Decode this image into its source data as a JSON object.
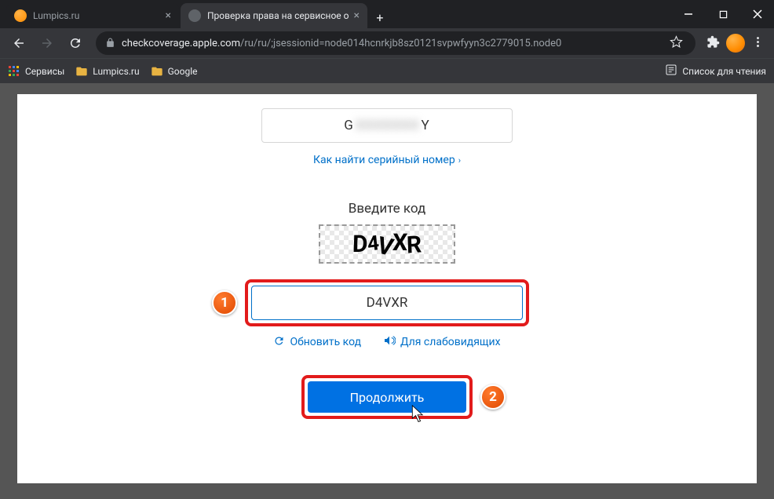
{
  "browser": {
    "tabs": [
      {
        "title": "Lumpics.ru",
        "active": false
      },
      {
        "title": "Проверка права на сервисное о",
        "active": true
      }
    ],
    "url_domain": "checkcoverage.apple.com",
    "url_path": "/ru/ru/;jsessionid=node014hcnrkjb8sz0121svpwfyyn3c2779015.node0",
    "bookmarks": {
      "services": "Сервисы",
      "lumpics": "Lumpics.ru",
      "google": "Google"
    },
    "reading_list": "Список для чтения"
  },
  "page": {
    "serial_first": "G",
    "serial_last": "Y",
    "find_serial_link": "Как найти серийный номер",
    "enter_code_label": "Введите код",
    "captcha_display": "D4VXR",
    "captcha_input_value": "D4VXR",
    "refresh_link": "Обновить код",
    "audio_link": "Для слабовидящих",
    "continue_button": "Продолжить"
  },
  "annotations": {
    "badge1": "1",
    "badge2": "2"
  }
}
